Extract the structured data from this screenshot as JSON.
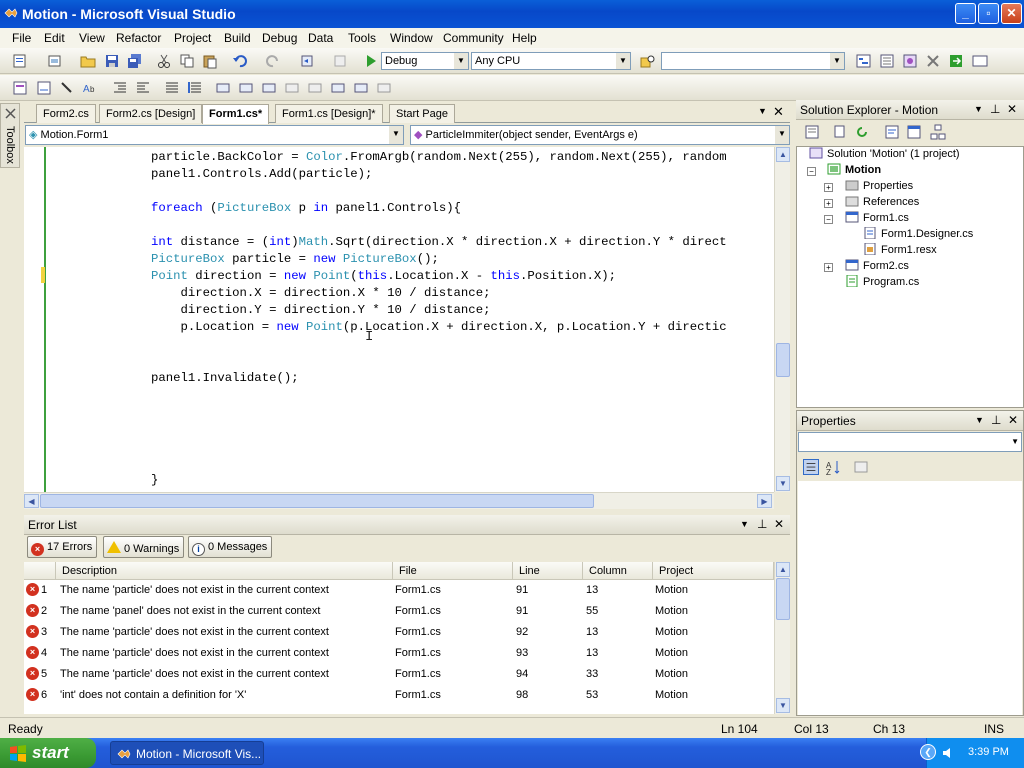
{
  "window": {
    "title": "Motion - Microsoft Visual Studio"
  },
  "menu": [
    "File",
    "Edit",
    "View",
    "Refactor",
    "Project",
    "Build",
    "Debug",
    "Data",
    "Tools",
    "Window",
    "Community",
    "Help"
  ],
  "toolbar": {
    "config": "Debug",
    "platform": "Any CPU",
    "find": ""
  },
  "toolbox": {
    "label": "Toolbox"
  },
  "tabs": [
    "Form2.cs",
    "Form2.cs [Design]",
    "Form1.cs*",
    "Form1.cs [Design]*",
    "Start Page"
  ],
  "nav": {
    "class": "Motion.Form1",
    "member": "ParticleImmiter(object sender, EventArgs e)"
  },
  "code": [
    {
      "t": "particle.BackColor = Color.FromArgb(random.Next(255), random.Next(255), random"
    },
    {
      "t": "panel1.Controls.Add(particle);"
    },
    {
      "t": "foreach (PictureBox p in panel1.Controls){"
    },
    {
      "t": "int distance = (int)Math.Sqrt(direction.X * direction.X + direction.Y * direct"
    },
    {
      "t": "PictureBox particle = new PictureBox();"
    },
    {
      "t": "Point direction = new Point(this.Location.X - this.Position.X);"
    },
    {
      "t": "    direction.X = direction.X * 10 / distance;"
    },
    {
      "t": "    direction.Y = direction.Y * 10 / distance;"
    },
    {
      "t": "    p.Location = new Point(p.Location.X + direction.X, p.Location.Y + directic"
    },
    {
      "t": "panel1.Invalidate();"
    },
    {
      "t": "}"
    }
  ],
  "solution": {
    "header": "Solution Explorer - Motion",
    "root": "Solution 'Motion' (1 project)",
    "project": "Motion",
    "items": [
      "Properties",
      "References",
      "Form1.cs",
      "Form1.Designer.cs",
      "Form1.resx",
      "Form2.cs",
      "Program.cs"
    ]
  },
  "properties": {
    "header": "Properties"
  },
  "errorlist": {
    "header": "Error List",
    "errors": "17 Errors",
    "warnings": "0 Warnings",
    "messages": "0 Messages",
    "columns": [
      "Description",
      "File",
      "Line",
      "Column",
      "Project"
    ],
    "rows": [
      {
        "n": "1",
        "desc": "The name 'particle' does not exist in the current context",
        "file": "Form1.cs",
        "line": "91",
        "col": "13",
        "proj": "Motion"
      },
      {
        "n": "2",
        "desc": "The name 'panel' does not exist in the current context",
        "file": "Form1.cs",
        "line": "91",
        "col": "55",
        "proj": "Motion"
      },
      {
        "n": "3",
        "desc": "The name 'particle' does not exist in the current context",
        "file": "Form1.cs",
        "line": "92",
        "col": "13",
        "proj": "Motion"
      },
      {
        "n": "4",
        "desc": "The name 'particle' does not exist in the current context",
        "file": "Form1.cs",
        "line": "93",
        "col": "13",
        "proj": "Motion"
      },
      {
        "n": "5",
        "desc": "The name 'particle' does not exist in the current context",
        "file": "Form1.cs",
        "line": "94",
        "col": "33",
        "proj": "Motion"
      },
      {
        "n": "6",
        "desc": "'int' does not contain a definition for 'X'",
        "file": "Form1.cs",
        "line": "98",
        "col": "53",
        "proj": "Motion"
      }
    ]
  },
  "status": {
    "ready": "Ready",
    "ln": "Ln 104",
    "col": "Col 13",
    "ch": "Ch 13",
    "mode": "INS"
  },
  "taskbar": {
    "start": "start",
    "item": "Motion - Microsoft Vis...",
    "clock": "3:39 PM"
  }
}
